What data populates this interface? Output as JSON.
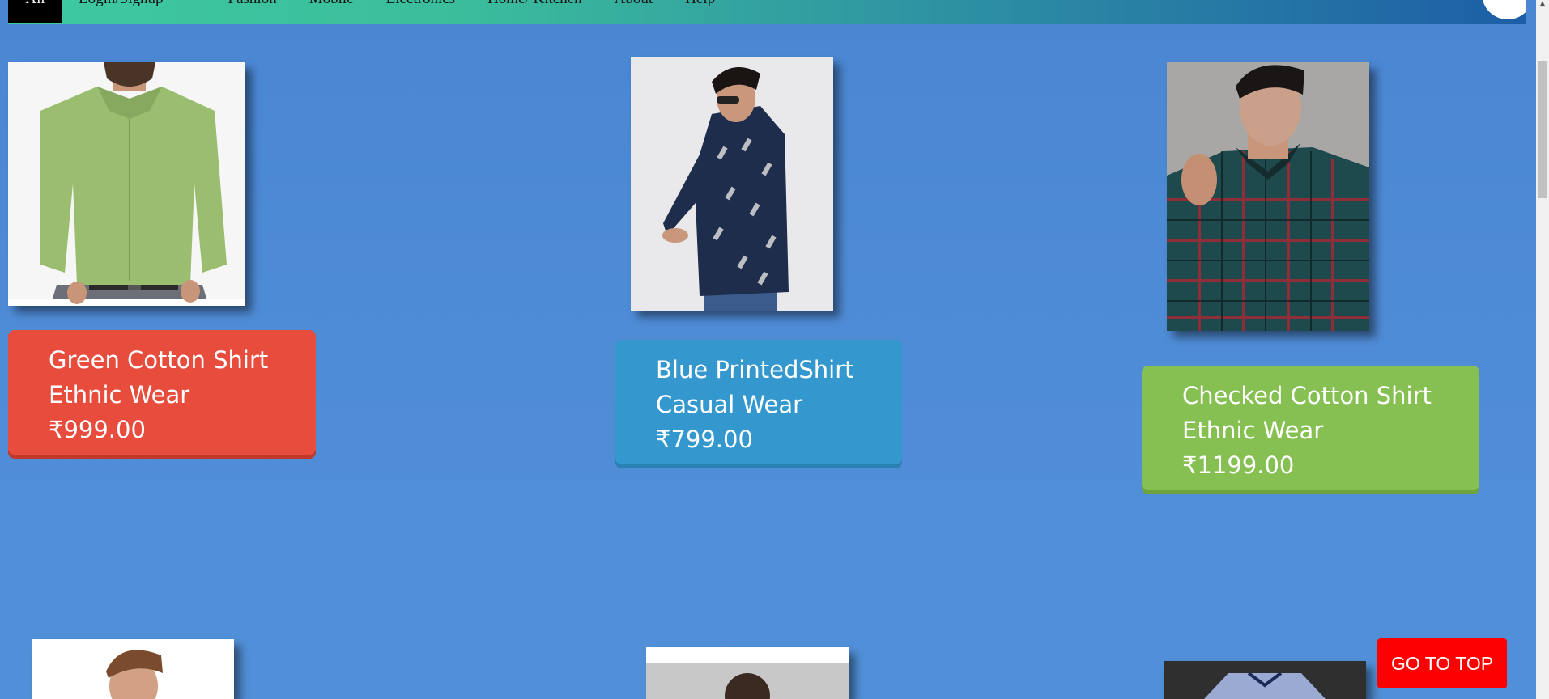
{
  "nav": {
    "all_label": "All",
    "links": [
      "Login/Signup",
      "Fashion",
      "Mobile",
      "Electronics",
      "Home/ Kitchen",
      "About",
      "Help"
    ]
  },
  "products": [
    {
      "title": "Green Cotton Shirt",
      "category": "Ethnic Wear",
      "price": "₹999.00",
      "card_color": "#e84c3d",
      "image": "green-shirt-photo"
    },
    {
      "title": "Blue PrintedShirt",
      "category": "Casual Wear",
      "price": "₹799.00",
      "card_color": "#3498cf",
      "image": "blue-printed-shirt-photo"
    },
    {
      "title": "Checked Cotton Shirt",
      "category": "Ethnic Wear",
      "price": "₹1199.00",
      "card_color": "#86bf52",
      "image": "checked-shirt-photo"
    }
  ],
  "go_top": {
    "label": "GO TO TOP",
    "color": "#fd0000"
  },
  "colors": {
    "background": "#4f8cd6",
    "nav_start": "#3ec9a0",
    "nav_end": "#1d5ea6"
  }
}
